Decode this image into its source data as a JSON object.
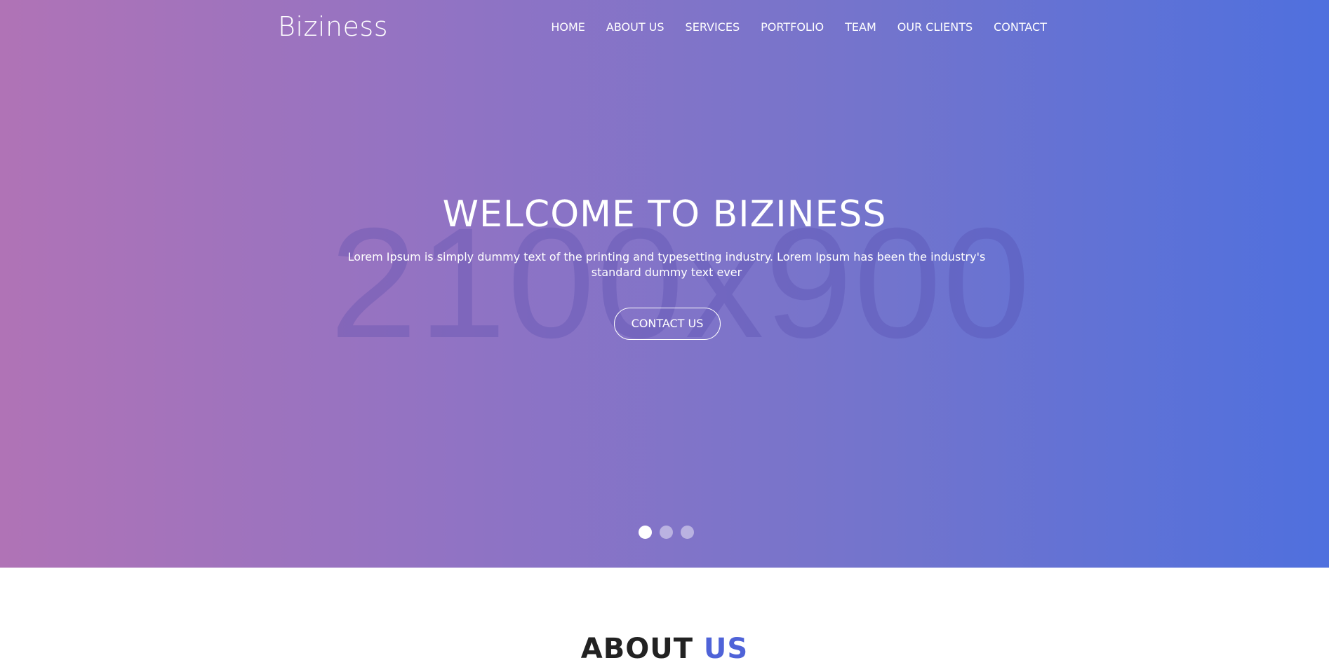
{
  "header": {
    "brand": "Biziness",
    "nav": [
      "HOME",
      "ABOUT US",
      "SERVICES",
      "PORTFOLIO",
      "TEAM",
      "OUR CLIENTS",
      "CONTACT"
    ]
  },
  "hero": {
    "placeholder_text": "2100x900",
    "title": "WELCOME TO BIZINESS",
    "subtitle": "Lorem Ipsum is simply dummy text of the printing and typesetting industry. Lorem Ipsum has been the industry's standard dummy text ever",
    "button_label": "CONTACT US",
    "slides": 3,
    "active_slide": 1
  },
  "about": {
    "title_main": "ABOUT",
    "title_accent": "US"
  },
  "colors": {
    "gradient_start": "#b073b6",
    "gradient_end": "#4f70de",
    "accent": "#4f63d8"
  }
}
